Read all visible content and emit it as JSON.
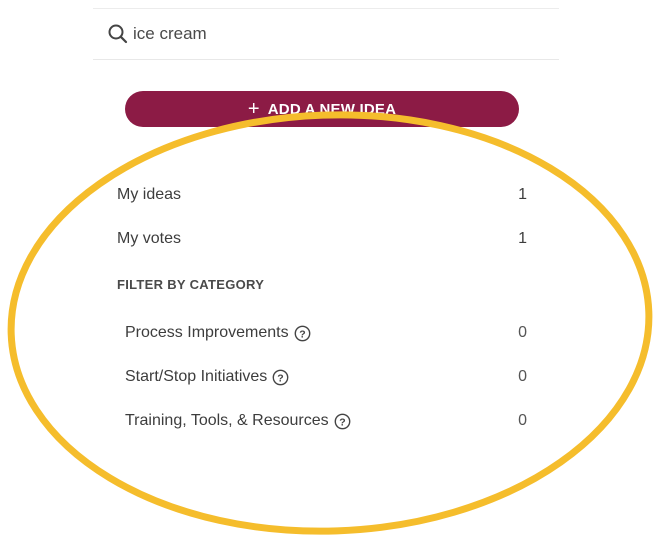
{
  "search": {
    "value": "ice cream"
  },
  "actions": {
    "add_idea_label": "ADD A NEW IDEA"
  },
  "my_items": [
    {
      "label": "My ideas",
      "count": "1"
    },
    {
      "label": "My votes",
      "count": "1"
    }
  ],
  "filter": {
    "heading": "FILTER BY CATEGORY",
    "categories": [
      {
        "label": "Process Improvements",
        "count": "0"
      },
      {
        "label": "Start/Stop Initiatives",
        "count": "0"
      },
      {
        "label": "Training, Tools, & Resources",
        "count": "0"
      }
    ]
  },
  "colors": {
    "button_bg": "#8c1b45",
    "highlight_outline": "#f5bd2c"
  },
  "icons": {
    "search": "search-icon",
    "help": "question-circle-icon",
    "add": "plus-icon"
  }
}
